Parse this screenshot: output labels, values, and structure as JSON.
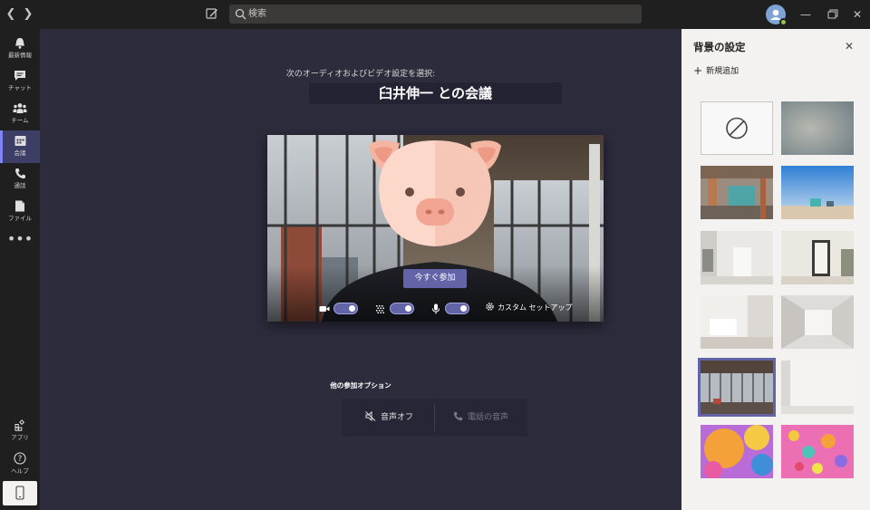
{
  "topbar": {
    "back_icon": "chevron-left-icon",
    "forward_icon": "chevron-right-icon",
    "compose_icon": "compose-icon",
    "search_placeholder": "検索",
    "window_controls": [
      "minimize-icon",
      "maximize-icon",
      "close-icon"
    ]
  },
  "rail": {
    "items": [
      {
        "label": "最新情報",
        "icon": "bell-icon"
      },
      {
        "label": "チャット",
        "icon": "chat-icon"
      },
      {
        "label": "チーム",
        "icon": "teams-icon"
      },
      {
        "label": "会議",
        "icon": "calendar-icon",
        "active": true
      },
      {
        "label": "通話",
        "icon": "phone-icon"
      },
      {
        "label": "ファイル",
        "icon": "file-icon"
      }
    ],
    "more": "•••",
    "bottom": [
      {
        "label": "アプリ",
        "icon": "apps-icon"
      },
      {
        "label": "ヘルプ",
        "icon": "help-icon"
      }
    ]
  },
  "main": {
    "prompt": "次のオーディオおよびビデオ設定を選択:",
    "meeting_title": "臼井伸一 との会議",
    "join_button": "今すぐ参加",
    "controls": {
      "camera_on": true,
      "blur_on": true,
      "mic_on": true,
      "custom_setup": "カスタム セットアップ"
    },
    "other_options_title": "他の参加オプション",
    "audio_off": "音声オフ",
    "phone_audio": "電話の音声"
  },
  "panel": {
    "title": "背景の設定",
    "add_new": "新規追加",
    "backgrounds": [
      {
        "kind": "none"
      },
      {
        "kind": "blur"
      },
      {
        "kind": "office"
      },
      {
        "kind": "beach"
      },
      {
        "kind": "white-room"
      },
      {
        "kind": "white-loft"
      },
      {
        "kind": "white-wall"
      },
      {
        "kind": "white-space"
      },
      {
        "kind": "current-room",
        "selected": true
      },
      {
        "kind": "white-plain"
      },
      {
        "kind": "balloons-orange"
      },
      {
        "kind": "balloons-pink"
      }
    ]
  },
  "colors": {
    "accent": "#6264a7",
    "rail_bg": "#201f1f",
    "main_bg": "#2d2c3d",
    "panel_bg": "#f3f2f1"
  }
}
